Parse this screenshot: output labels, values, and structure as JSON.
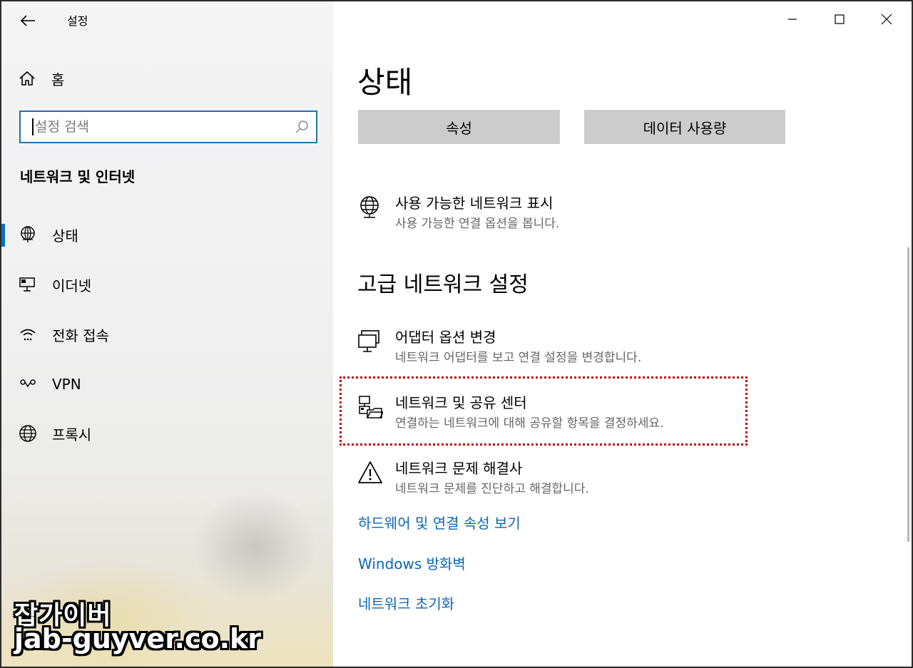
{
  "window": {
    "title": "설정",
    "minimize_icon": "minimize-icon",
    "maximize_icon": "maximize-icon",
    "close_icon": "close-icon"
  },
  "sidebar": {
    "home_label": "홈",
    "search_placeholder": "설정 검색",
    "section_title": "네트워크 및 인터넷",
    "items": [
      {
        "label": "상태",
        "icon": "globe-network-icon",
        "active": true
      },
      {
        "label": "이더넷",
        "icon": "ethernet-icon",
        "active": false
      },
      {
        "label": "전화 접속",
        "icon": "dialup-icon",
        "active": false
      },
      {
        "label": "VPN",
        "icon": "vpn-icon",
        "active": false
      },
      {
        "label": "프록시",
        "icon": "globe-icon",
        "active": false
      }
    ]
  },
  "main": {
    "title": "상태",
    "buttons": {
      "properties": "속성",
      "data_usage": "데이터 사용량"
    },
    "show_networks": {
      "title": "사용 가능한 네트워크 표시",
      "desc": "사용 가능한 연결 옵션을 봅니다."
    },
    "advanced_heading": "고급 네트워크 설정",
    "adapter": {
      "title": "어댑터 옵션 변경",
      "desc": "네트워크 어댑터를 보고 연결 설정을 변경합니다."
    },
    "sharing": {
      "title": "네트워크 및 공유 센터",
      "desc": "연결하는 네트워크에 대해 공유할 항목을 결정하세요."
    },
    "troubleshoot": {
      "title": "네트워크 문제 해결사",
      "desc": "네트워크 문제를 진단하고 해결합니다."
    },
    "links": [
      "하드웨어 및 연결 속성 보기",
      "Windows 방화벽",
      "네트워크 초기화"
    ]
  },
  "watermark": {
    "line1": "잡가이버",
    "line2": "jab-guyver.co.kr"
  },
  "colors": {
    "accent": "#0b6fc2",
    "link": "#0a66b8",
    "highlight": "#c00000"
  }
}
